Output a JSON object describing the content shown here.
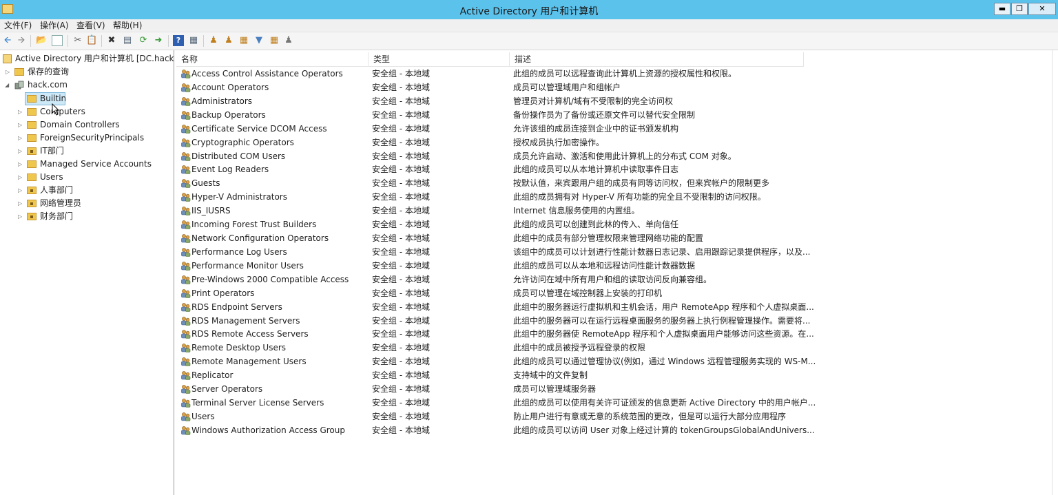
{
  "window": {
    "title": "Active Directory 用户和计算机",
    "controls": [
      "minimize-icon",
      "restore-icon",
      "close-icon"
    ]
  },
  "menu": [
    "文件(F)",
    "操作(A)",
    "查看(V)",
    "帮助(H)"
  ],
  "toolbar": {
    "icons": [
      "back-arrow-icon",
      "forward-arrow-icon",
      "up-folder-icon",
      "show-hide-tree-icon",
      "cut-icon",
      "copy-icon",
      "delete-icon",
      "properties-icon",
      "refresh-icon",
      "export-list-icon",
      "help-icon",
      "console-icon",
      "new-user-icon",
      "new-group-icon",
      "new-ou-icon",
      "filter-icon",
      "find-icon",
      "add-to-group-icon"
    ]
  },
  "tree": {
    "root": "Active Directory 用户和计算机 [DC.hack.com",
    "saved_queries": "保存的查询",
    "domain": "hack.com",
    "selected": "Builtin",
    "children": [
      "Computers",
      "Domain Controllers",
      "ForeignSecurityPrincipals",
      "IT部门",
      "Managed Service Accounts",
      "Users",
      "人事部门",
      "网络管理员",
      "财务部门"
    ]
  },
  "list": {
    "columns": [
      "名称",
      "类型",
      "描述"
    ],
    "rows": [
      {
        "name": "Access Control Assistance Operators",
        "type": "安全组 - 本地域",
        "desc": "此组的成员可以远程查询此计算机上资源的授权属性和权限。"
      },
      {
        "name": "Account Operators",
        "type": "安全组 - 本地域",
        "desc": "成员可以管理域用户和组帐户"
      },
      {
        "name": "Administrators",
        "type": "安全组 - 本地域",
        "desc": "管理员对计算机/域有不受限制的完全访问权"
      },
      {
        "name": "Backup Operators",
        "type": "安全组 - 本地域",
        "desc": "备份操作员为了备份或还原文件可以替代安全限制"
      },
      {
        "name": "Certificate Service DCOM Access",
        "type": "安全组 - 本地域",
        "desc": "允许该组的成员连接到企业中的证书颁发机构"
      },
      {
        "name": "Cryptographic Operators",
        "type": "安全组 - 本地域",
        "desc": "授权成员执行加密操作。"
      },
      {
        "name": "Distributed COM Users",
        "type": "安全组 - 本地域",
        "desc": "成员允许启动、激活和使用此计算机上的分布式 COM 对象。"
      },
      {
        "name": "Event Log Readers",
        "type": "安全组 - 本地域",
        "desc": "此组的成员可以从本地计算机中读取事件日志"
      },
      {
        "name": "Guests",
        "type": "安全组 - 本地域",
        "desc": "按默认值，来宾跟用户组的成员有同等访问权，但来宾帐户的限制更多"
      },
      {
        "name": "Hyper-V Administrators",
        "type": "安全组 - 本地域",
        "desc": "此组的成员拥有对 Hyper-V 所有功能的完全且不受限制的访问权限。"
      },
      {
        "name": "IIS_IUSRS",
        "type": "安全组 - 本地域",
        "desc": "Internet 信息服务使用的内置组。"
      },
      {
        "name": "Incoming Forest Trust Builders",
        "type": "安全组 - 本地域",
        "desc": "此组的成员可以创建到此林的传入、单向信任"
      },
      {
        "name": "Network Configuration Operators",
        "type": "安全组 - 本地域",
        "desc": "此组中的成员有部分管理权限来管理网络功能的配置"
      },
      {
        "name": "Performance Log Users",
        "type": "安全组 - 本地域",
        "desc": "该组中的成员可以计划进行性能计数器日志记录、启用跟踪记录提供程序，以及..."
      },
      {
        "name": "Performance Monitor Users",
        "type": "安全组 - 本地域",
        "desc": "此组的成员可以从本地和远程访问性能计数器数据"
      },
      {
        "name": "Pre-Windows 2000 Compatible Access",
        "type": "安全组 - 本地域",
        "desc": "允许访问在域中所有用户和组的读取访问反向兼容组。"
      },
      {
        "name": "Print Operators",
        "type": "安全组 - 本地域",
        "desc": "成员可以管理在域控制器上安装的打印机"
      },
      {
        "name": "RDS Endpoint Servers",
        "type": "安全组 - 本地域",
        "desc": "此组中的服务器运行虚拟机和主机会话，用户 RemoteApp 程序和个人虚拟桌面..."
      },
      {
        "name": "RDS Management Servers",
        "type": "安全组 - 本地域",
        "desc": "此组中的服务器可以在运行远程桌面服务的服务器上执行例程管理操作。需要将..."
      },
      {
        "name": "RDS Remote Access Servers",
        "type": "安全组 - 本地域",
        "desc": "此组中的服务器使 RemoteApp 程序和个人虚拟桌面用户能够访问这些资源。在..."
      },
      {
        "name": "Remote Desktop Users",
        "type": "安全组 - 本地域",
        "desc": "此组中的成员被授予远程登录的权限"
      },
      {
        "name": "Remote Management Users",
        "type": "安全组 - 本地域",
        "desc": "此组的成员可以通过管理协议(例如，通过 Windows 远程管理服务实现的 WS-M..."
      },
      {
        "name": "Replicator",
        "type": "安全组 - 本地域",
        "desc": "支持域中的文件复制"
      },
      {
        "name": "Server Operators",
        "type": "安全组 - 本地域",
        "desc": "成员可以管理域服务器"
      },
      {
        "name": "Terminal Server License Servers",
        "type": "安全组 - 本地域",
        "desc": "此组的成员可以使用有关许可证颁发的信息更新 Active Directory 中的用户帐户..."
      },
      {
        "name": "Users",
        "type": "安全组 - 本地域",
        "desc": "防止用户进行有意或无意的系统范围的更改，但是可以运行大部分应用程序"
      },
      {
        "name": "Windows Authorization Access Group",
        "type": "安全组 - 本地域",
        "desc": "此组的成员可以访问 User 对象上经过计算的 tokenGroupsGlobalAndUnivers..."
      }
    ]
  },
  "colors": {
    "titlebar": "#5bc2ec",
    "selection": "#cde8f7",
    "folder": "#f0c74d"
  }
}
